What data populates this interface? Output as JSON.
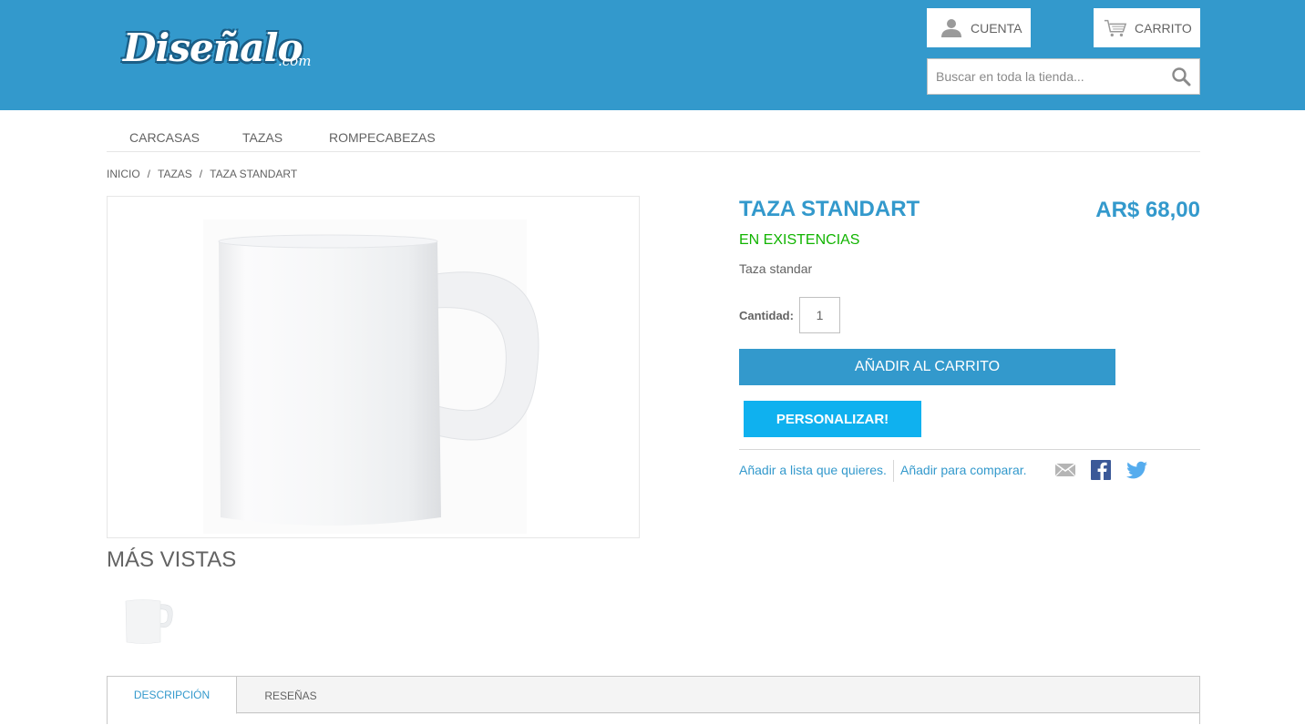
{
  "header": {
    "logo_text": "Diseñalo",
    "logo_suffix": ".com",
    "account_label": "CUENTA",
    "cart_label": "CARRITO",
    "search_placeholder": "Buscar en toda la tienda...",
    "background_color": "#3399cc"
  },
  "nav": {
    "items": [
      {
        "label": "CARCASAS"
      },
      {
        "label": "TAZAS"
      },
      {
        "label": "ROMPECABEZAS"
      }
    ]
  },
  "breadcrumb": {
    "items": [
      "INICIO",
      "TAZAS",
      "TAZA STANDART"
    ],
    "separator": "/"
  },
  "product": {
    "name": "TAZA STANDART",
    "price": "AR$ 68,00",
    "availability": "EN EXISTENCIAS",
    "short_description": "Taza standar",
    "quantity_label": "Cantidad:",
    "quantity_value": "1",
    "add_to_cart_label": "AÑADIR AL CARRITO",
    "customize_label": "PERSONALIZAR!",
    "wishlist_link": "Añadir a lista que quieres.",
    "compare_link": "Añadir para comparar.",
    "accent_color": "#3399cc",
    "stock_color": "#11b400",
    "customize_color": "#0fb1ef"
  },
  "more_views": {
    "title": "MÁS VISTAS"
  },
  "social": {
    "icons": [
      "email-icon",
      "facebook-icon",
      "twitter-icon"
    ]
  },
  "tabs": [
    {
      "label": "DESCRIPCIÓN",
      "active": true
    },
    {
      "label": "RESEÑAS",
      "active": false
    }
  ]
}
